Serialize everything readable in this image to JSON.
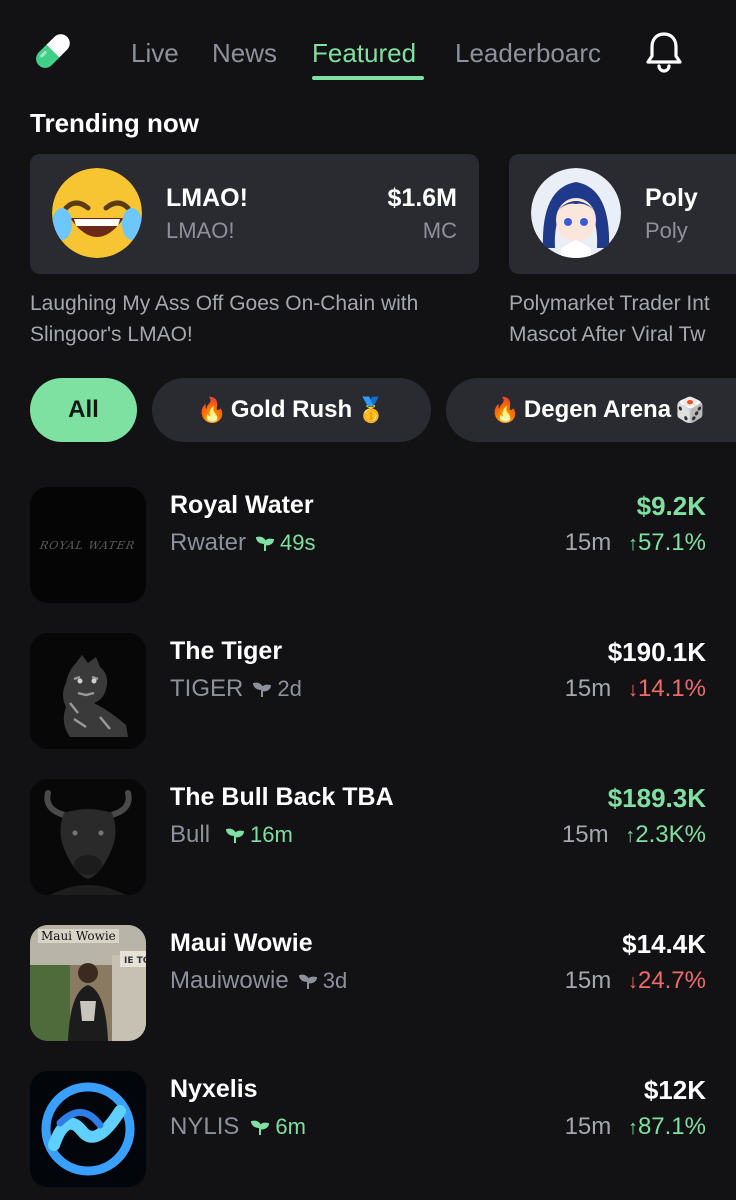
{
  "nav": {
    "tabs": [
      {
        "label": "Live",
        "active": false
      },
      {
        "label": "News",
        "active": false
      },
      {
        "label": "Featured",
        "active": true
      },
      {
        "label": "Leaderboarc",
        "active": false
      }
    ],
    "accent_color": "#7ee0a1",
    "logo_icon": "pill-logo-icon",
    "notifications_icon": "bell-icon"
  },
  "trending": {
    "title": "Trending now",
    "cards": [
      {
        "name": "LMAO!",
        "ticker": "LMAO!",
        "market_cap": "$1.6M",
        "market_cap_label": "MC",
        "description": "Laughing My Ass Off Goes On-Chain with\nSlingoor's LMAO!"
      },
      {
        "name": "Poly",
        "ticker": "Poly",
        "description": "Polymarket Trader Int\nMascot After Viral Tw"
      }
    ]
  },
  "filters": [
    {
      "label": "All",
      "active": true
    },
    {
      "label": "Gold Rush",
      "active": false,
      "prefix_emoji": "🔥",
      "suffix_emoji": "🥇"
    },
    {
      "label": "Degen Arena",
      "active": false,
      "prefix_emoji": "🔥",
      "suffix_emoji": "🎲"
    }
  ],
  "tokens": [
    {
      "name": "Royal Water",
      "ticker": "Rwater",
      "age": "49s",
      "age_fresh": true,
      "price": "$9.2K",
      "price_color": "green",
      "interval": "15m",
      "direction": "up",
      "change": "57.1%",
      "thumb_text": "ROYAL WATER"
    },
    {
      "name": "The Tiger",
      "ticker": "TIGER",
      "age": "2d",
      "age_fresh": false,
      "price": "$190.1K",
      "price_color": "white",
      "interval": "15m",
      "direction": "down",
      "change": "14.1%"
    },
    {
      "name": "The Bull Back TBA",
      "ticker": "Bull",
      "age": "16m",
      "age_fresh": true,
      "price": "$189.3K",
      "price_color": "green",
      "interval": "15m",
      "direction": "up",
      "change": "2.3K%"
    },
    {
      "name": "Maui Wowie",
      "ticker": "Mauiwowie",
      "age": "3d",
      "age_fresh": false,
      "price": "$14.4K",
      "price_color": "white",
      "interval": "15m",
      "direction": "down",
      "change": "24.7%",
      "thumb_text": "Maui Wowie"
    },
    {
      "name": "Nyxelis",
      "ticker": "NYLIS",
      "age": "6m",
      "age_fresh": true,
      "price": "$12K",
      "price_color": "white",
      "interval": "15m",
      "direction": "up",
      "change": "87.1%"
    }
  ],
  "arrows": {
    "up": "↑",
    "down": "↓"
  }
}
